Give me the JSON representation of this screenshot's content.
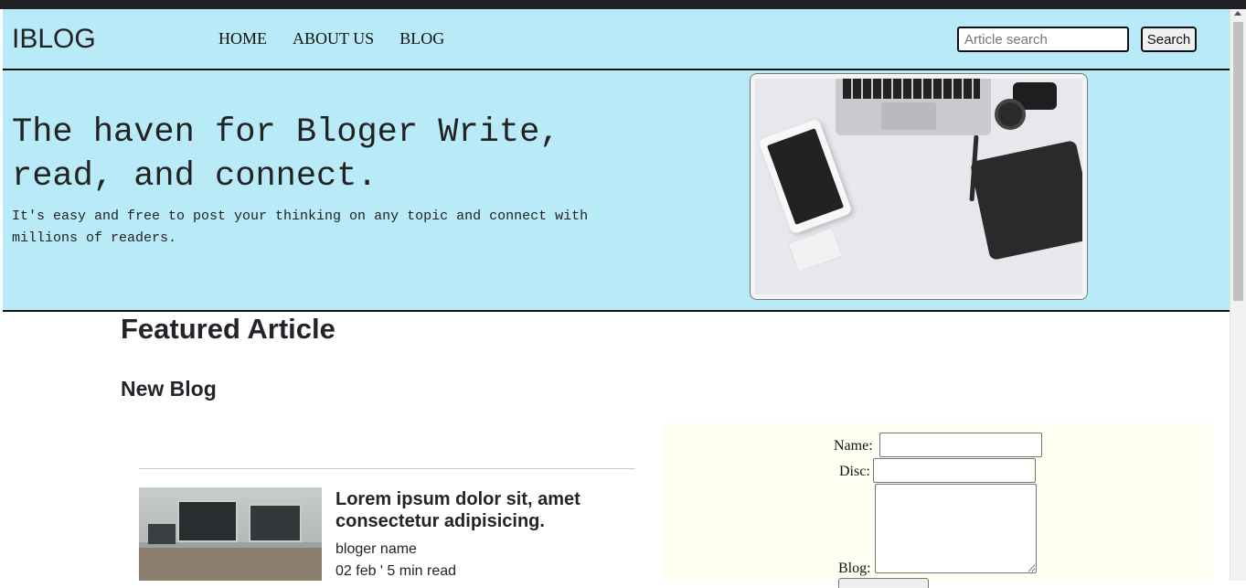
{
  "navbar": {
    "brand": "IBLOG",
    "links": [
      "HOME",
      "ABOUT US",
      "BLOG"
    ],
    "search_placeholder": "Article search",
    "search_button": "Search",
    "background": "#b8eaf7"
  },
  "hero": {
    "title": "The haven for Bloger Write, read, and connect.",
    "subtitle": "It's easy and free to post your thinking on any topic and connect with millions of readers."
  },
  "main": {
    "heading": "Featured Article",
    "subheading": "New Blog"
  },
  "article": {
    "title": "Lorem ipsum dolor sit, amet consectetur adipisicing.",
    "author": "bloger name",
    "meta": "02 feb ' 5 min read"
  },
  "form": {
    "name_label": "Name:",
    "disc_label": "Disc:",
    "blog_label": "Blog:",
    "background": "#fefff0"
  }
}
